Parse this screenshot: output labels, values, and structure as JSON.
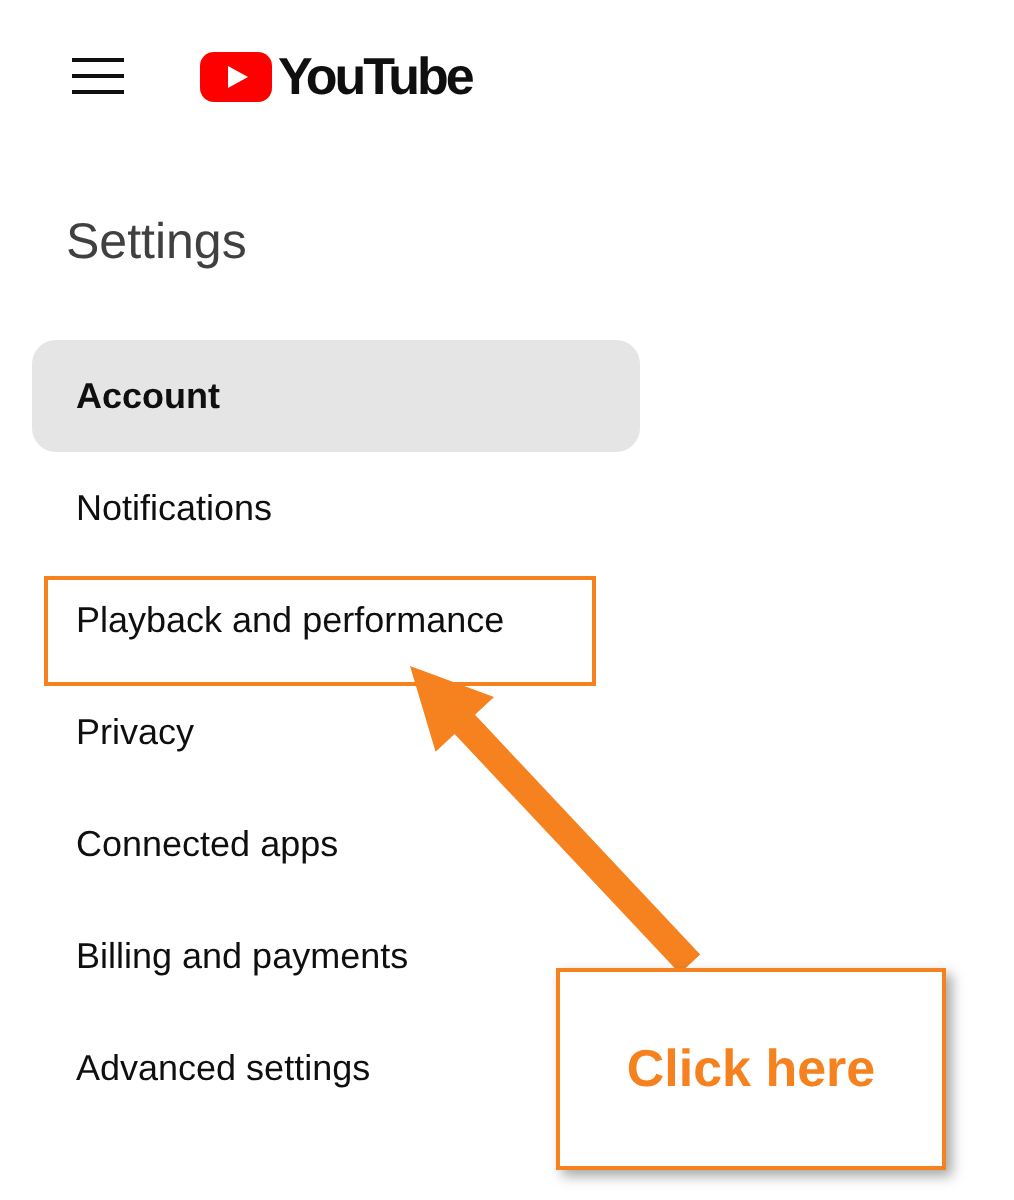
{
  "header": {
    "logo_text": "YouTube"
  },
  "settings": {
    "title": "Settings",
    "items": [
      {
        "label": "Account",
        "selected": true
      },
      {
        "label": "Notifications",
        "selected": false
      },
      {
        "label": "Playback and performance",
        "selected": false
      },
      {
        "label": "Privacy",
        "selected": false
      },
      {
        "label": "Connected apps",
        "selected": false
      },
      {
        "label": "Billing and payments",
        "selected": false
      },
      {
        "label": "Advanced settings",
        "selected": false
      }
    ]
  },
  "annotation": {
    "callout": "Click here"
  }
}
